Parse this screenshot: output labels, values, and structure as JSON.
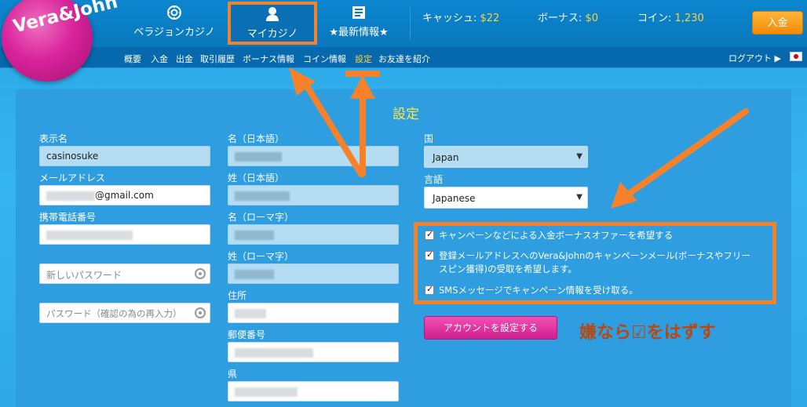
{
  "brand": {
    "logo_text": "Vera&John",
    "accent": "#f5822a",
    "pink": "#d9239b",
    "yellow": "#ffd23a"
  },
  "nav": {
    "items": [
      {
        "label": "ベラジョンカジノ",
        "icon": "chip-icon"
      },
      {
        "label": "マイカジノ",
        "icon": "user-icon"
      },
      {
        "label": "★最新情報★",
        "icon": "news-icon"
      }
    ]
  },
  "balance": {
    "cash_label": "キャッシュ: ",
    "cash_value": "$22",
    "bonus_label": "ボーナス: ",
    "bonus_value": "$0",
    "coin_label": "コイン: ",
    "coin_value": "1,230",
    "deposit_button": "入金"
  },
  "subnav": {
    "links": [
      "概要",
      "入金",
      "出金",
      "取引履歴",
      "ボーナス情報",
      "コイン情報",
      "設定",
      "お友達を紹介"
    ],
    "active": "設定",
    "logout": "ログアウト"
  },
  "page": {
    "heading": "設定"
  },
  "form": {
    "display_name_label": "表示名",
    "display_name_value": "casinosuke",
    "email_label": "メールアドレス",
    "email_value": "@gmail.com",
    "phone_label": "携帯電話番号",
    "new_password_placeholder": "新しいパスワード",
    "confirm_password_placeholder": "パスワード（確認の為の再入力）",
    "first_name_jp_label": "名（日本語）",
    "last_name_jp_label": "姓（日本語）",
    "first_name_roman_label": "名（ローマ字）",
    "last_name_roman_label": "姓（ローマ字）",
    "address_label": "住所",
    "postal_code_label": "郵便番号",
    "prefecture_label": "県",
    "country_label": "国",
    "country_value": "Japan",
    "language_label": "言語",
    "language_value": "Japanese"
  },
  "preferences": {
    "items": [
      {
        "label": "キャンペーンなどによる入金ボーナスオファーを希望する",
        "checked": true
      },
      {
        "label": "登録メールアドレスへのVera&Johnのキャンペーンメール(ボーナスやフリースピン獲得)の受取を希望します。",
        "checked": true
      },
      {
        "label": "SMSメッセージでキャンペーン情報を受け取る。",
        "checked": true
      }
    ]
  },
  "submit_button": "アカウントを設定する",
  "annotation": "嫌なら☑をはずす"
}
